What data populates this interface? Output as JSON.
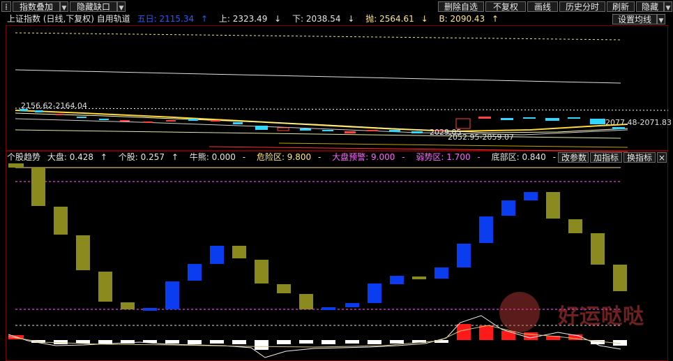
{
  "toolbar": {
    "left_buttons": [
      {
        "label": "指数叠加",
        "name": "index-overlay-button"
      },
      {
        "label": "隐藏缺口",
        "name": "hide-gap-button"
      }
    ],
    "right_buttons": [
      {
        "label": "删除自选",
        "name": "delete-watchlist-button"
      },
      {
        "label": "不复权",
        "name": "no-adjust-button"
      },
      {
        "label": "画线",
        "name": "draw-line-button"
      },
      {
        "label": "历史分时",
        "name": "history-intraday-button"
      },
      {
        "label": "刷新",
        "name": "refresh-button"
      },
      {
        "label": "隐藏",
        "name": "hide-button"
      }
    ],
    "settings_label": "设置均线"
  },
  "upper": {
    "title": "上证指数 (日线,下复权) 自用轨道",
    "items": [
      {
        "label": "五日: 2115.34",
        "arrow": "↑",
        "color": "#2a5bff"
      },
      {
        "label": "上: 2323.49",
        "arrow": "↓",
        "color": "#e6e6e6"
      },
      {
        "label": "下: 2038.54",
        "arrow": "↓",
        "color": "#e6e6e6"
      },
      {
        "label": "抛: 2564.61",
        "arrow": "↓",
        "color": "#ffe680"
      },
      {
        "label": "B: 2090.43",
        "arrow": "↑",
        "color": "#ffe680"
      }
    ],
    "annotations": [
      "2156.62-2164.04",
      "2077.48-2071.83",
      "2029.05",
      "2052.95-2059.07"
    ]
  },
  "lower": {
    "title": "个股趋势",
    "items": [
      {
        "label": "大盘: 0.428",
        "arrow": "↑",
        "color": "#e6e6e6"
      },
      {
        "label": "个股: 0.257",
        "arrow": "↑",
        "color": "#e6e6e6"
      },
      {
        "label": "牛熊: 0.000",
        "arrow": "-",
        "color": "#e6e6e6"
      },
      {
        "label": "危险区: 9.800",
        "arrow": "-",
        "color": "#ffe680"
      },
      {
        "label": "大盘预警: 9.000",
        "arrow": "-",
        "color": "#ff66ff"
      },
      {
        "label": "弱势区: 1.700",
        "arrow": "-",
        "color": "#ff66ff"
      },
      {
        "label": "底部区: 0.840",
        "arrow": "-",
        "color": "#e6e6e6"
      }
    ],
    "buttons": [
      {
        "label": "改参数",
        "name": "change-params-button"
      },
      {
        "label": "加指标",
        "name": "add-indicator-button"
      },
      {
        "label": "换指标",
        "name": "switch-indicator-button"
      }
    ]
  },
  "watermark": "好运哒哒",
  "colors": {
    "olive": "#8a8a1e",
    "blue": "#0a3cf0",
    "red": "#ff1a1a",
    "cyan": "#33d6ff"
  }
}
